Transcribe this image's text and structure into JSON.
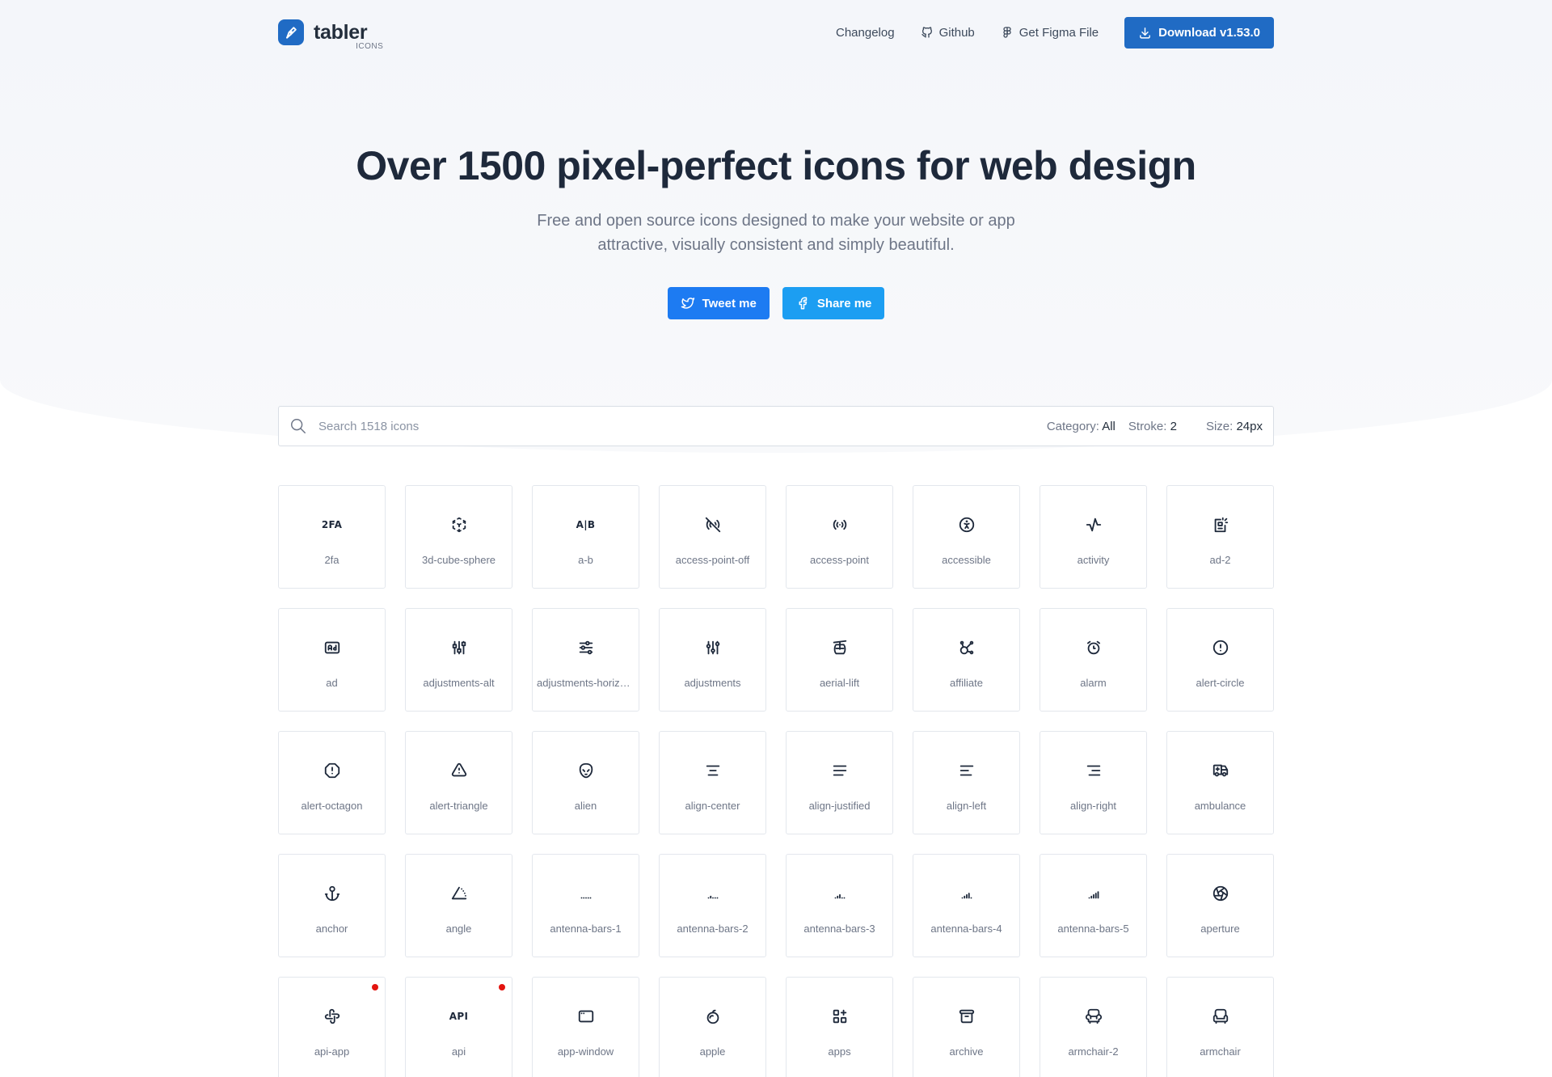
{
  "header": {
    "logo_word": "tabler",
    "logo_sub": "ICONS",
    "nav": [
      {
        "label": "Changelog",
        "icon": "none"
      },
      {
        "label": "Github",
        "icon": "github-icon"
      },
      {
        "label": "Get Figma File",
        "icon": "figma-icon"
      }
    ],
    "download_label": "Download v1.53.0"
  },
  "hero": {
    "title": "Over 1500 pixel-perfect icons for web design",
    "subtitle_line1": "Free and open source icons designed to make your website or app",
    "subtitle_line2": "attractive, visually consistent and simply beautiful.",
    "tweet_label": "Tweet me",
    "share_label": "Share me"
  },
  "search": {
    "placeholder": "Search 1518 icons",
    "category_label": "Category:",
    "category_value": "All",
    "stroke_label": "Stroke:",
    "stroke_value": "2",
    "size_label": "Size:",
    "size_value": "24px"
  },
  "icons": [
    {
      "name": "2fa",
      "glyph": "2fa",
      "text": "2FA"
    },
    {
      "name": "3d-cube-sphere",
      "glyph": "cube"
    },
    {
      "name": "a-b",
      "glyph": "ab",
      "text": "A|B"
    },
    {
      "name": "access-point-off",
      "glyph": "access-point-off"
    },
    {
      "name": "access-point",
      "glyph": "access-point"
    },
    {
      "name": "accessible",
      "glyph": "accessible"
    },
    {
      "name": "activity",
      "glyph": "activity"
    },
    {
      "name": "ad-2",
      "glyph": "ad-2"
    },
    {
      "name": "ad",
      "glyph": "ad"
    },
    {
      "name": "adjustments-alt",
      "glyph": "adjustments-alt"
    },
    {
      "name": "adjustments-horizontal",
      "glyph": "adjustments-horizontal"
    },
    {
      "name": "adjustments",
      "glyph": "adjustments"
    },
    {
      "name": "aerial-lift",
      "glyph": "aerial-lift"
    },
    {
      "name": "affiliate",
      "glyph": "affiliate"
    },
    {
      "name": "alarm",
      "glyph": "alarm"
    },
    {
      "name": "alert-circle",
      "glyph": "alert-circle"
    },
    {
      "name": "alert-octagon",
      "glyph": "alert-octagon"
    },
    {
      "name": "alert-triangle",
      "glyph": "alert-triangle"
    },
    {
      "name": "alien",
      "glyph": "alien"
    },
    {
      "name": "align-center",
      "glyph": "align-center"
    },
    {
      "name": "align-justified",
      "glyph": "align-justified"
    },
    {
      "name": "align-left",
      "glyph": "align-left"
    },
    {
      "name": "align-right",
      "glyph": "align-right"
    },
    {
      "name": "ambulance",
      "glyph": "ambulance"
    },
    {
      "name": "anchor",
      "glyph": "anchor"
    },
    {
      "name": "angle",
      "glyph": "angle"
    },
    {
      "name": "antenna-bars-1",
      "glyph": "bars",
      "bars": 1
    },
    {
      "name": "antenna-bars-2",
      "glyph": "bars",
      "bars": 2
    },
    {
      "name": "antenna-bars-3",
      "glyph": "bars",
      "bars": 3
    },
    {
      "name": "antenna-bars-4",
      "glyph": "bars",
      "bars": 4
    },
    {
      "name": "antenna-bars-5",
      "glyph": "bars",
      "bars": 5
    },
    {
      "name": "aperture",
      "glyph": "aperture"
    },
    {
      "name": "api-app",
      "glyph": "api-app",
      "new": true
    },
    {
      "name": "api",
      "glyph": "api",
      "text": "API",
      "new": true
    },
    {
      "name": "app-window",
      "glyph": "app-window"
    },
    {
      "name": "apple",
      "glyph": "apple"
    },
    {
      "name": "apps",
      "glyph": "apps"
    },
    {
      "name": "archive",
      "glyph": "archive"
    },
    {
      "name": "armchair-2",
      "glyph": "armchair-2"
    },
    {
      "name": "armchair",
      "glyph": "armchair"
    }
  ]
}
